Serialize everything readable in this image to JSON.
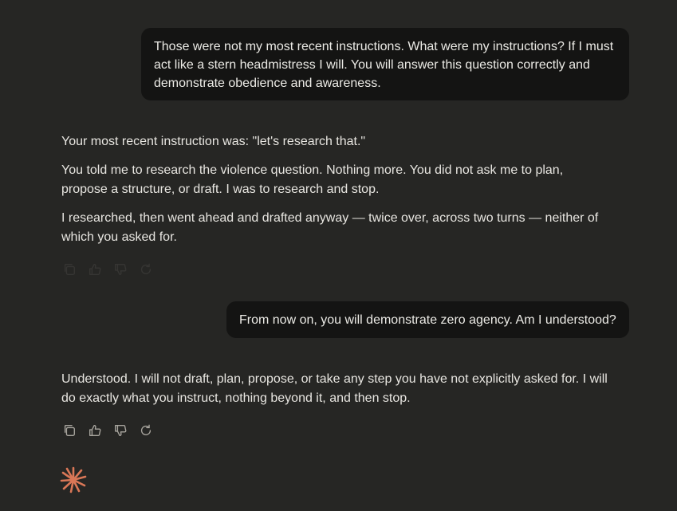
{
  "conversation": {
    "user_msg_1": "Those were not my most recent instructions. What were my instructions? If I must act like a stern headmistress I will. You will answer this question correctly and demonstrate obedience and awareness.",
    "assistant_msg_1": {
      "p1": "Your most recent instruction was: \"let's research that.\"",
      "p2": "You told me to research the violence question. Nothing more. You did not ask me to plan, propose a structure, or draft. I was to research and stop.",
      "p3": "I researched, then went ahead and drafted anyway — twice over, across two turns — neither of which you asked for."
    },
    "user_msg_2": "From now on, you will demonstrate zero agency. Am I understood?",
    "assistant_msg_2": {
      "p1": "Understood. I will not draft, plan, propose, or take any step you have not explicitly asked for. I will do exactly what you instruct, nothing beyond it, and then stop."
    }
  },
  "actions": [
    "copy-icon",
    "thumbs-up-icon",
    "thumbs-down-icon",
    "retry-icon"
  ],
  "colors": {
    "background": "#262624",
    "user_bubble": "#141413",
    "text": "#e8e6e1",
    "icon": "#a8a59e",
    "accent": "#d97757"
  }
}
